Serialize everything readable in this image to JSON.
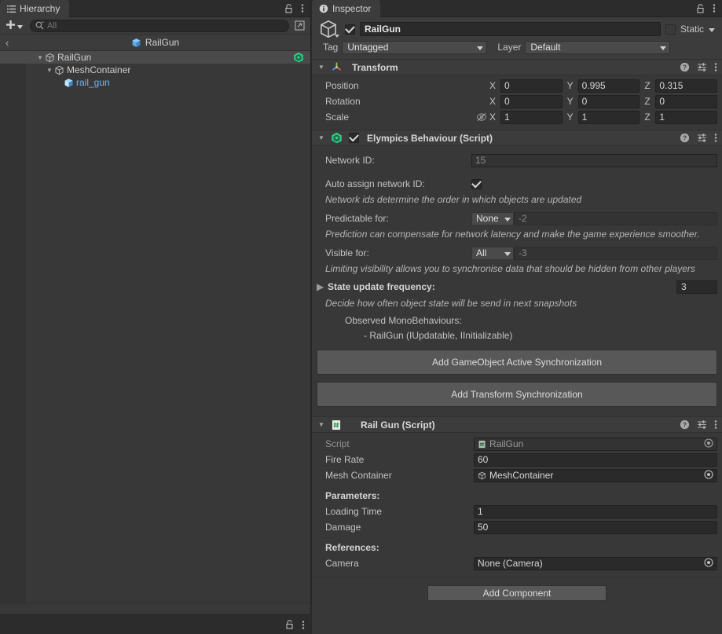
{
  "hierarchy": {
    "tab_label": "Hierarchy",
    "tab_icon": "hierarchy-icon",
    "lock_icon": "lock-icon",
    "menu_icon": "kebab-menu-icon",
    "toolbar": {
      "add_label": "+",
      "add_dropdown_icon": "chevron-down-icon",
      "search_icon": "search-icon",
      "search_value": "",
      "search_placeholder": "All",
      "expand_icon": "open-in-new-icon"
    },
    "breadcrumb": {
      "back_icon": "chevron-left-icon",
      "prefab_icon": "prefab-cube-icon",
      "label": "RailGun"
    },
    "items": [
      {
        "label": "RailGun",
        "icon": "gameobject-cube-icon",
        "indent": 1,
        "twisty": "▼",
        "selected": true,
        "badge": "elympics-icon",
        "prefab": false
      },
      {
        "label": "MeshContainer",
        "icon": "gameobject-cube-icon",
        "indent": 2,
        "twisty": "▼",
        "selected": false,
        "badge": "",
        "prefab": false
      },
      {
        "label": "rail_gun",
        "icon": "mesh-prefab-icon",
        "indent": 3,
        "twisty": "",
        "selected": false,
        "badge": "",
        "prefab": true
      }
    ],
    "bottom_lock_icon": "lock-icon",
    "bottom_menu_icon": "kebab-menu-icon"
  },
  "inspector": {
    "tab_label": "Inspector",
    "tab_icon": "info-icon",
    "lock_icon": "lock-icon",
    "menu_icon": "kebab-menu-icon",
    "gameobject": {
      "icon": "gameobject-cube-icon",
      "enabled": true,
      "name": "RailGun",
      "static_label": "Static",
      "static_checked": false,
      "static_dropdown_icon": "chevron-down-icon",
      "tag_label": "Tag",
      "tag_value": "Untagged",
      "layer_label": "Layer",
      "layer_value": "Default"
    },
    "transform": {
      "title": "Transform",
      "icon": "transform-axis-icon",
      "foldout": "▼",
      "help_icon": "help-icon",
      "preset_icon": "preset-sliders-icon",
      "menu_icon": "kebab-menu-icon",
      "rows": [
        {
          "label": "Position",
          "x": "0",
          "y": "0.995",
          "z": "0.315",
          "has_link": false
        },
        {
          "label": "Rotation",
          "x": "0",
          "y": "0",
          "z": "0",
          "has_link": false
        },
        {
          "label": "Scale",
          "x": "1",
          "y": "1",
          "z": "1",
          "has_link": true,
          "link_icon": "constrain-proportions-off-icon"
        }
      ],
      "axis_labels": {
        "x": "X",
        "y": "Y",
        "z": "Z"
      }
    },
    "elympics": {
      "title": "Elympics Behaviour (Script)",
      "icon": "elympics-icon",
      "foldout": "▼",
      "enabled": true,
      "help_icon": "help-icon",
      "preset_icon": "preset-sliders-icon",
      "menu_icon": "kebab-menu-icon",
      "network_id_label": "Network ID:",
      "network_id_value": "15",
      "auto_assign_label": "Auto assign network ID:",
      "auto_assign_checked": true,
      "auto_assign_hint": "Network ids determine the order in which objects are updated",
      "predictable_label": "Predictable for:",
      "predictable_value": "None",
      "predictable_raw": "-2",
      "predictable_hint": "Prediction can compensate for network latency and make the game experience smoother.",
      "visible_label": "Visible for:",
      "visible_value": "All",
      "visible_raw": "-3",
      "visible_hint": "Limiting visibility allows you to synchronise data that should be hidden from other players",
      "state_freq_label": "State update frequency:",
      "state_freq_foldout": "▶",
      "state_freq_value": "3",
      "state_freq_hint": "Decide how often object state will be send in next snapshots",
      "observed_title": "Observed MonoBehaviours:",
      "observed_items": [
        "- RailGun (IUpdatable, IInitializable)"
      ],
      "btn_gameobject_sync": "Add GameObject Active Synchronization",
      "btn_transform_sync": "Add Transform Synchronization"
    },
    "railgun": {
      "title": "Rail Gun (Script)",
      "icon": "csharp-script-icon",
      "foldout": "▼",
      "help_icon": "help-icon",
      "preset_icon": "preset-sliders-icon",
      "menu_icon": "kebab-menu-icon",
      "script_label": "Script",
      "script_value": "RailGun",
      "script_icon": "csharp-script-icon",
      "picker_icon": "object-picker-icon",
      "fire_rate_label": "Fire Rate",
      "fire_rate_value": "60",
      "mesh_container_label": "Mesh Container",
      "mesh_container_value": "MeshContainer",
      "mesh_container_icon": "gameobject-cube-icon",
      "parameters_header": "Parameters:",
      "loading_time_label": "Loading Time",
      "loading_time_value": "1",
      "damage_label": "Damage",
      "damage_value": "50",
      "references_header": "References:",
      "camera_label": "Camera",
      "camera_value": "None (Camera)"
    },
    "add_component_label": "Add Component"
  },
  "colors": {
    "panel_bg": "#383838",
    "header_bg": "#3c3c3c",
    "window_bg": "#292929",
    "field_bg": "#2a2a2a",
    "button_bg": "#585858",
    "text": "#c4c4c4",
    "prefab_blue": "#6ab7ff",
    "elympics_green": "#2fd18b"
  }
}
